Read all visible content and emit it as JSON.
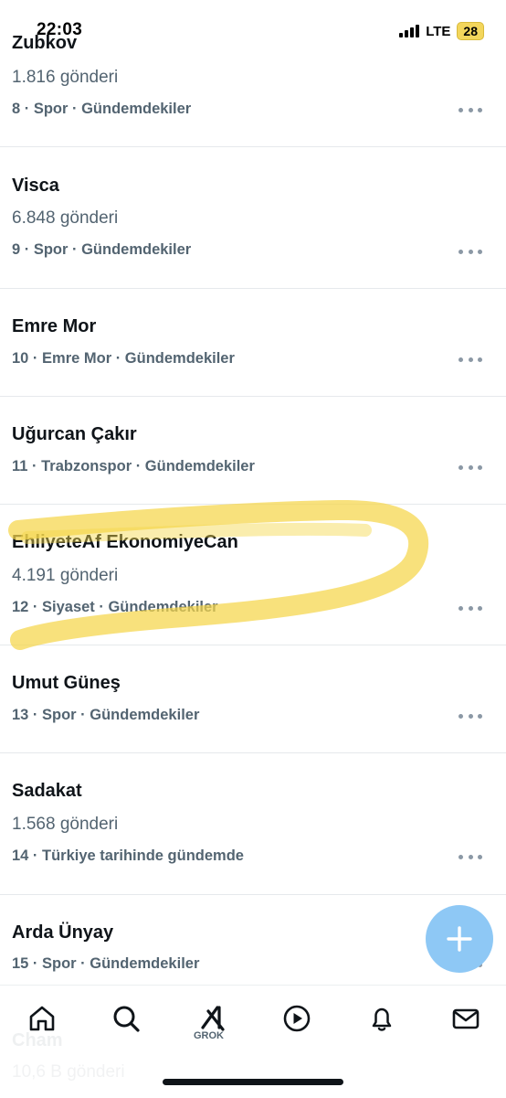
{
  "status_bar": {
    "time": "22:03",
    "network": "LTE",
    "battery": "28"
  },
  "trends": [
    {
      "title": "Zubkov",
      "posts": "1.816 gönderi",
      "meta": "8 · Spor · Gündemdekiler"
    },
    {
      "title": "Visca",
      "posts": "6.848 gönderi",
      "meta": "9 · Spor · Gündemdekiler"
    },
    {
      "title": "Emre Mor",
      "posts": "",
      "meta": "10 · Emre Mor · Gündemdekiler"
    },
    {
      "title": "Uğurcan Çakır",
      "posts": "",
      "meta": "11 · Trabzonspor · Gündemdekiler"
    },
    {
      "title": "EhliyeteAf EkonomiyeCan",
      "posts": "4.191 gönderi",
      "meta": "12 · Siyaset · Gündemdekiler"
    },
    {
      "title": "Umut Güneş",
      "posts": "",
      "meta": "13 · Spor · Gündemdekiler"
    },
    {
      "title": "Sadakat",
      "posts": "1.568 gönderi",
      "meta": "14 · Türkiye tarihinde gündemde"
    },
    {
      "title": "Arda Ünyay",
      "posts": "",
      "meta": "15 · Spor · Gündemdekiler"
    }
  ],
  "partial_trend": {
    "title": "Cham",
    "posts": "10,6 B gönderi"
  },
  "bottom_nav": {
    "grok_label": "GROK"
  },
  "icons": {
    "home": "home-icon",
    "search": "search-icon",
    "grok": "grok-icon",
    "video": "play-icon",
    "notifications": "bell-icon",
    "messages": "mail-icon",
    "compose": "plus-icon",
    "more": "more-dots-icon"
  },
  "colors": {
    "accent_fab": "#8ec8f5",
    "highlight": "#f5d64a",
    "secondary_text": "#536471"
  }
}
